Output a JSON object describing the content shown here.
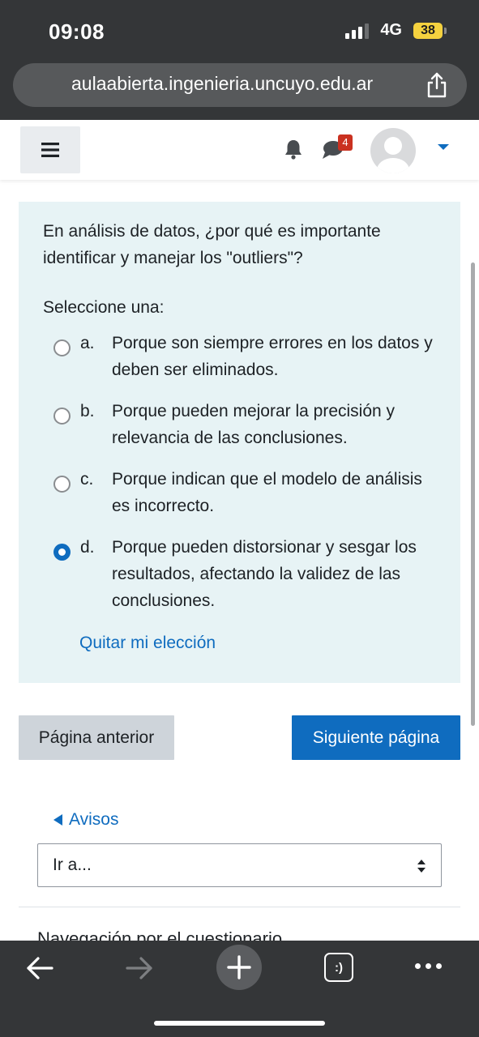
{
  "status_bar": {
    "time": "09:08",
    "network": "4G",
    "battery": "38"
  },
  "browser": {
    "url": "aulaabierta.ingenieria.uncuyo.edu.ar"
  },
  "navbar": {
    "messages_badge": "4"
  },
  "question": {
    "text": "En análisis de datos, ¿por qué es importante identificar y manejar los \"outliers\"?",
    "prompt": "Seleccione una:",
    "options": [
      {
        "letter": "a.",
        "text": "Porque son siempre errores en los datos y deben ser eliminados.",
        "selected": false
      },
      {
        "letter": "b.",
        "text": "Porque pueden mejorar la precisión y relevancia de las conclusiones.",
        "selected": false
      },
      {
        "letter": "c.",
        "text": "Porque indican que el modelo de análisis es incorrecto.",
        "selected": false
      },
      {
        "letter": "d.",
        "text": "Porque pueden distorsionar y sesgar los resultados, afectando la validez de las conclusiones.",
        "selected": true
      }
    ],
    "clear_choice": "Quitar mi elección"
  },
  "nav_buttons": {
    "prev": "Página anterior",
    "next": "Siguiente página"
  },
  "activity_nav": {
    "prev_link": "Avisos",
    "jump_placeholder": "Ir a..."
  },
  "quiz_nav_heading": "Navegación por el cuestionario",
  "toolbar": {
    "tabs_label": ":)"
  },
  "colors": {
    "accent": "#0f6cbf",
    "card_bg": "#e7f3f5",
    "badge": "#ca3120"
  }
}
